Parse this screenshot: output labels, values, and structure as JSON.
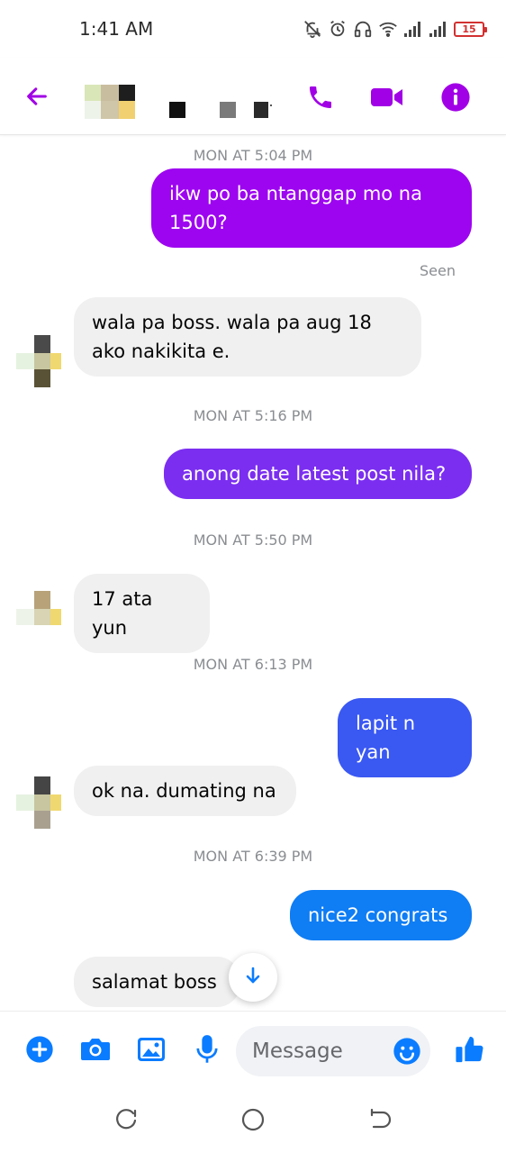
{
  "status_bar": {
    "time": "1:41 AM",
    "battery": "15",
    "icons": [
      "mute-bell-icon",
      "alarm-icon",
      "headset-icon",
      "wifi-icon",
      "signal-icon",
      "signal-icon",
      "battery-icon"
    ]
  },
  "header": {
    "icons": [
      "back-arrow-icon",
      "phone-icon",
      "video-camera-icon",
      "info-icon"
    ],
    "accent_color": "#a100e6"
  },
  "messages": [
    {
      "type": "timestamp",
      "text": "MON AT 5:04 PM"
    },
    {
      "type": "outgoing",
      "text": "ikw po ba ntanggap mo na 1500?",
      "color": "#9d05f0"
    },
    {
      "type": "seen",
      "text": "Seen"
    },
    {
      "type": "incoming",
      "text": "wala pa boss. wala pa aug 18 ako nakikita e."
    },
    {
      "type": "timestamp",
      "text": "MON AT 5:16 PM"
    },
    {
      "type": "outgoing",
      "text": "anong date latest post nila?",
      "color": "#7b2ef0"
    },
    {
      "type": "timestamp",
      "text": "MON AT 5:50 PM"
    },
    {
      "type": "incoming",
      "text": "17 ata yun"
    },
    {
      "type": "timestamp",
      "text": "MON AT 6:13 PM"
    },
    {
      "type": "outgoing",
      "text": "lapit n yan",
      "color": "#3a58f2"
    },
    {
      "type": "incoming",
      "text": "ok na. dumating na"
    },
    {
      "type": "timestamp",
      "text": "MON AT 6:39 PM"
    },
    {
      "type": "outgoing",
      "text": "nice2 congrats",
      "color": "#0f7df4"
    },
    {
      "type": "incoming",
      "text": "salamat boss"
    }
  ],
  "composer": {
    "placeholder": "Message",
    "icons": [
      "plus-icon",
      "camera-icon",
      "gallery-icon",
      "microphone-icon",
      "emoji-icon",
      "thumbs-up-icon"
    ],
    "accent_color": "#0a7cff"
  },
  "navbar": {
    "icons": [
      "recent-apps-icon",
      "home-icon",
      "back-icon"
    ]
  }
}
